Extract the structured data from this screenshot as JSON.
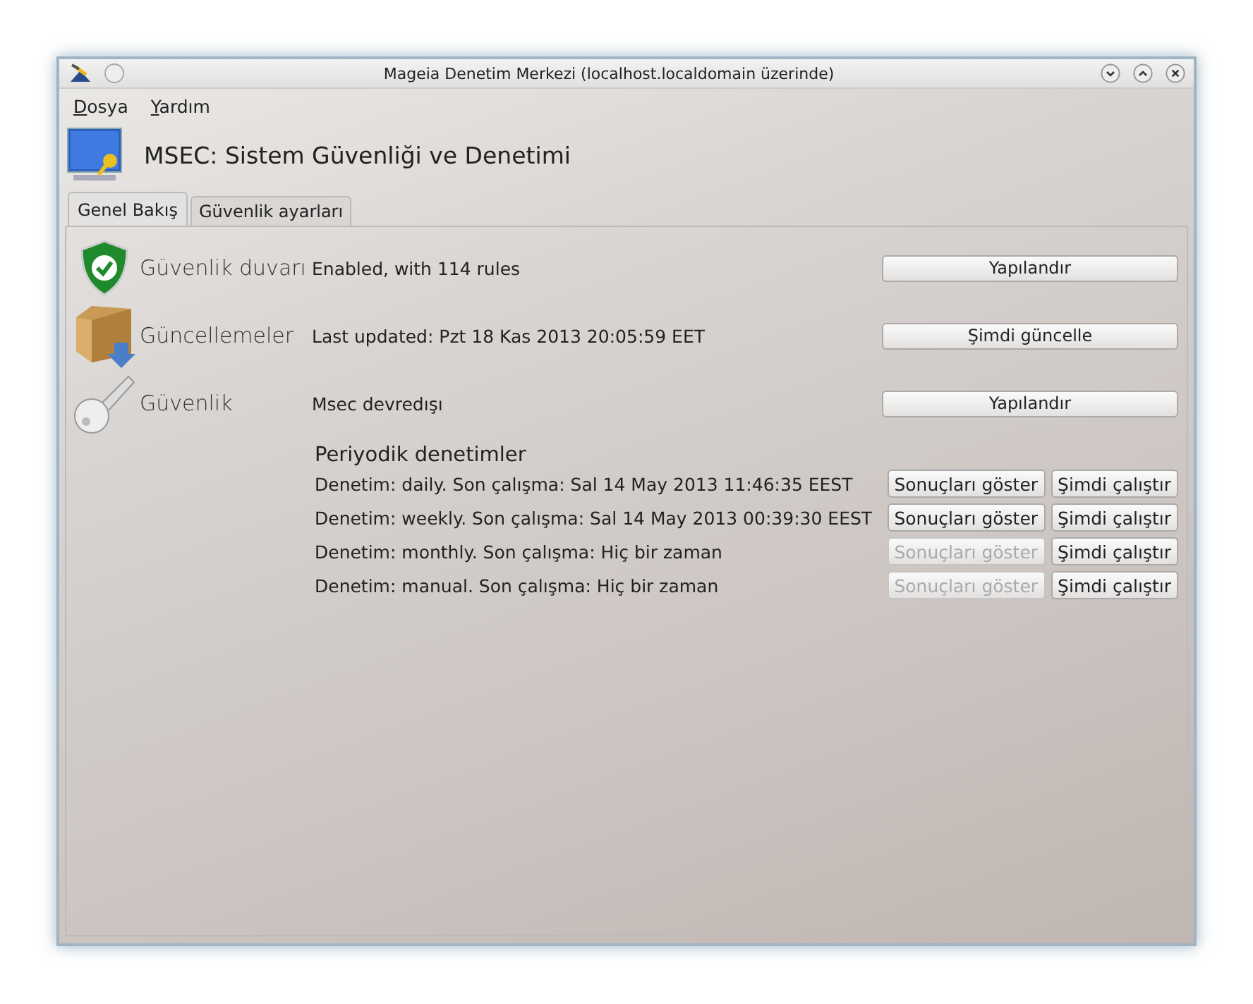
{
  "window": {
    "title": "Mageia Denetim Merkezi  (localhost.localdomain üzerinde)"
  },
  "menu": [
    "Dosya",
    "Yardım"
  ],
  "header": {
    "title": "MSEC: Sistem Güvenliği ve Denetimi"
  },
  "tabs": [
    {
      "label": "Genel Bakış",
      "selected": true
    },
    {
      "label": "Güvenlik ayarları",
      "selected": false
    }
  ],
  "sections": [
    {
      "name": "Güvenlik duvarı",
      "status": "Enabled, with 114 rules",
      "button": "Yapılandır"
    },
    {
      "name": "Güncellemeler",
      "status": "Last updated: Pzt 18 Kas 2013 20:05:59 EET",
      "button": "Şimdi güncelle"
    },
    {
      "name": "Güvenlik",
      "status": "Msec devredışı",
      "button": "Yapılandır"
    }
  ],
  "audits": {
    "title": "Periyodik denetimler",
    "rows": [
      {
        "text": "Denetim: daily. Son çalışma: Sal 14 May 2013 11:46:35 EEST",
        "results_button": {
          "label": "Sonuçları göster",
          "disabled": false
        },
        "run_button": "Şimdi çalıştır"
      },
      {
        "text": "Denetim: weekly. Son çalışma: Sal 14 May 2013 00:39:30 EEST",
        "results_button": {
          "label": "Sonuçları göster",
          "disabled": false
        },
        "run_button": "Şimdi çalıştır"
      },
      {
        "text": "Denetim: monthly. Son çalışma: Hiç bir zaman",
        "results_button": {
          "label": "Sonuçları göster",
          "disabled": true
        },
        "run_button": "Şimdi çalıştır"
      },
      {
        "text": "Denetim: manual. Son çalışma: Hiç bir zaman",
        "results_button": {
          "label": "Sonuçları göster",
          "disabled": true
        },
        "run_button": "Şimdi çalıştır"
      }
    ]
  }
}
